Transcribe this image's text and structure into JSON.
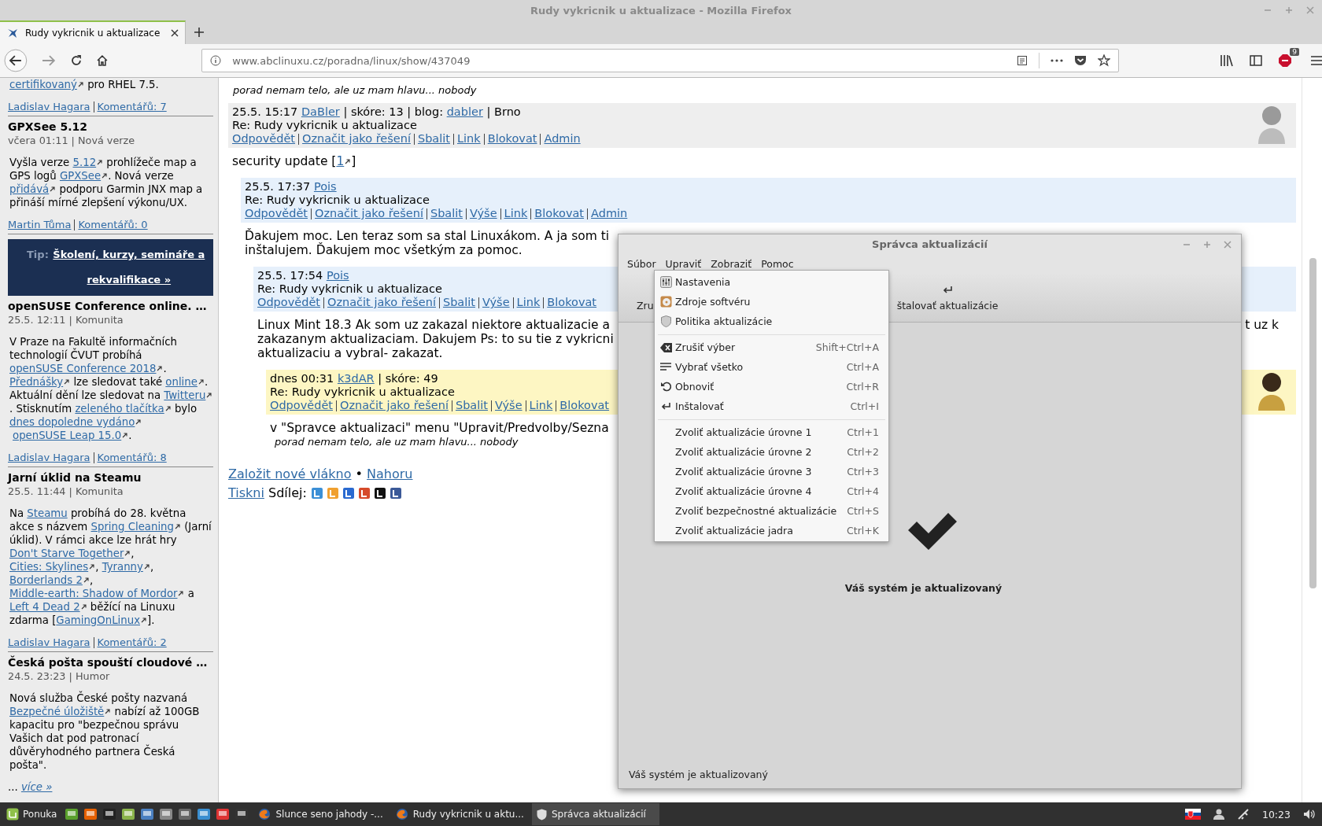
{
  "browser": {
    "title": "Rudy vykricnik u aktualizace - Mozilla Firefox",
    "tabs": [
      {
        "label": "Rudy vykricnik u aktualizace",
        "selected": true
      }
    ],
    "url": "www.abclinuxu.cz/poradna/linux/show/437049",
    "adblock_count": "9"
  },
  "sidebar": [
    {
      "kind": "article",
      "body": [
        {
          "link": "certifikovaný",
          "external": true
        },
        {
          "text": " pro RHEL 7.5."
        }
      ],
      "author": "Ladislav Hagara",
      "comments": "Komentářů: 7"
    },
    {
      "kind": "article",
      "title": "GPXSee 5.12",
      "meta": "včera 01:11 | Nová verze",
      "body": [
        {
          "text": "Vyšla verze "
        },
        {
          "link": "5.12",
          "external": true
        },
        {
          "text": " prohlížeče map a GPS logů "
        },
        {
          "link": "GPXSee",
          "external": true
        },
        {
          "text": ". Nová verze "
        },
        {
          "link": "přidává",
          "external": true
        },
        {
          "text": " podporu Garmin JNX map a přináší mírné zlepšení výkonu/UX."
        }
      ],
      "author": "Martin Tůma",
      "comments": "Komentářů: 0"
    },
    {
      "kind": "ad",
      "label": "Tip:",
      "link": "Školení, kurzy, semináře a rekvalifikace »"
    },
    {
      "kind": "article",
      "title": "openSUSE Conference online. …",
      "meta": "25.5. 12:11 | Komunita",
      "body": [
        {
          "text": "V Praze na Fakultě informačních technologií ČVUT probíhá "
        },
        {
          "link": "openSUSE Conference 2018",
          "external": true
        },
        {
          "text": ". "
        },
        {
          "link": "Přednášky",
          "external": true
        },
        {
          "text": " lze sledovat také "
        },
        {
          "link": "online",
          "external": true
        },
        {
          "text": ". Aktuální dění lze sledovat na "
        },
        {
          "link": "Twitteru",
          "external": true
        },
        {
          "text": ". Stisknutím "
        },
        {
          "link": "zeleného tlačítka",
          "external": true
        },
        {
          "text": " bylo "
        },
        {
          "link": "dnes dopoledne vydáno",
          "external": true
        },
        {
          "link": "openSUSE Leap 15.0",
          "external": true
        },
        {
          "text": "."
        }
      ],
      "author": "Ladislav Hagara",
      "comments": "Komentářů: 8"
    },
    {
      "kind": "article",
      "title": "Jarní úklid na Steamu",
      "meta": "25.5. 11:44 | Komunita",
      "body": [
        {
          "text": "Na "
        },
        {
          "link": "Steamu",
          "external": false
        },
        {
          "text": " probíhá do 28. května akce s názvem "
        },
        {
          "link": "Spring Cleaning",
          "external": true
        },
        {
          "text": " (Jarní úklid). V rámci akce lze hrát hry "
        },
        {
          "link": "Don't Starve Together",
          "external": true
        },
        {
          "text": ", "
        },
        {
          "link": "Cities: Skylines",
          "external": true
        },
        {
          "text": ", "
        },
        {
          "link": "Tyranny",
          "external": true
        },
        {
          "text": ", "
        },
        {
          "link": "Borderlands 2",
          "external": true
        },
        {
          "text": ", "
        },
        {
          "link": "Middle-earth: Shadow of Mordor",
          "external": true
        },
        {
          "text": " a "
        },
        {
          "link": "Left 4 Dead 2",
          "external": true
        },
        {
          "text": " běžící na Linuxu zdarma ["
        },
        {
          "link": "GamingOnLinux",
          "external": true
        },
        {
          "text": "]."
        }
      ],
      "author": "Ladislav Hagara",
      "comments": "Komentářů: 2"
    },
    {
      "kind": "article",
      "title": "Česká pošta spouští cloudové …",
      "meta": "24.5. 23:23 | Humor",
      "body": [
        {
          "text": "Nová služba České pošty nazvaná "
        },
        {
          "link": "Bezpečné úložiště",
          "external": true
        },
        {
          "text": " nabízí až 100GB kapacitu pro \"bezpečnou správu Vašich dat pod patronací důvěryhodného partnera Česká pošta\"."
        }
      ],
      "more_prefix": "... ",
      "more": "více »"
    }
  ],
  "thread": {
    "signature": "porad nemam telo, ale uz mam hlavu... nobody",
    "posts": [
      {
        "color": "#eeeeee",
        "avatar": true,
        "info": [
          {
            "text": "25.5. 15:17 "
          },
          {
            "link": "DaBler",
            "external": false
          },
          {
            "text": " | skóre: 13 | blog: "
          },
          {
            "link": "dabler",
            "external": false
          },
          {
            "text": " | Brno"
          }
        ],
        "subject": "Re: Rudy vykricnik u aktualizace",
        "actions": [
          "Odpovědět",
          "Označit jako řešení",
          "Sbalit",
          "Link",
          "Blokovat",
          "Admin"
        ],
        "lines": [
          {
            "segments": [
              {
                "text": "security update ["
              },
              {
                "link": "1",
                "external": true
              },
              {
                "text": "]"
              }
            ]
          }
        ],
        "children": [
          {
            "color": "#e6f0fb",
            "avatar": false,
            "info": [
              {
                "text": "25.5. 17:37 "
              },
              {
                "link": "Pois",
                "external": false
              }
            ],
            "subject": "Re: Rudy vykricnik u aktualizace",
            "actions": [
              "Odpovědět",
              "Označit jako řešení",
              "Sbalit",
              "Výše",
              "Link",
              "Blokovat",
              "Admin"
            ],
            "lines": [
              {
                "segments": [
                  {
                    "text": "Ďakujem moc. Len teraz som sa stal Linuxákom. A ja som ti"
                  }
                ]
              },
              {
                "segments": [
                  {
                    "text": "inštalujem. Ďakujem moc všetkým za pomoc."
                  }
                ]
              }
            ],
            "children": [
              {
                "color": "#e6f0fb",
                "avatar": false,
                "info": [
                  {
                    "text": "25.5. 17:54 "
                  },
                  {
                    "link": "Pois",
                    "external": false
                  }
                ],
                "subject": "Re: Rudy vykricnik u aktualizace",
                "actions": [
                  "Odpovědět",
                  "Označit jako řešení",
                  "Sbalit",
                  "Výše",
                  "Link",
                  "Blokovat"
                ],
                "lines": [
                  {
                    "segments": [
                      {
                        "text": "Linux Mint 18.3 Ak som uz zakazal niektore aktualizacie a"
                      }
                    ],
                    "continued": "t uz k"
                  },
                  {
                    "segments": [
                      {
                        "text": "zakazanym aktualizaciam. Dakujem Ps: to su tie z vykricni"
                      }
                    ]
                  },
                  {
                    "segments": [
                      {
                        "text": "aktualizaciu a vybral- zakazat."
                      }
                    ]
                  }
                ],
                "children": [
                  {
                    "color": "#fdf6c3",
                    "avatar": true,
                    "info": [
                      {
                        "text": "dnes 00:31 "
                      },
                      {
                        "link": "k3dAR",
                        "external": false
                      },
                      {
                        "text": " | skóre: 49"
                      }
                    ],
                    "subject": "Re: Rudy vykricnik u aktualizace",
                    "actions": [
                      "Odpovědět",
                      "Označit jako řešení",
                      "Sbalit",
                      "Výše",
                      "Link",
                      "Blokovat"
                    ],
                    "lines": [
                      {
                        "segments": [
                          {
                            "text": "v \"Spravce aktualizaci\" menu \"Upravit/Predvolby/Sezna"
                          }
                        ]
                      }
                    ],
                    "signature": "porad nemam telo, ale uz mam hlavu... nobody"
                  }
                ]
              }
            ]
          }
        ]
      }
    ],
    "footer": [
      [
        {
          "link": "Založit nové vlákno",
          "external": false
        },
        {
          "text": " • "
        },
        {
          "link": "Nahoru",
          "external": false
        }
      ],
      [
        {
          "link": "Tiskni",
          "external": false
        },
        {
          "text": " Sdílej: "
        }
      ]
    ]
  },
  "dialog": {
    "title": "Správca aktualizácií",
    "menubar": [
      "Súbor",
      "Upraviť",
      "Zobraziť",
      "Pomoc"
    ],
    "toolbar": [
      "Zru",
      "štalovať aktualizácie"
    ],
    "menu_groups": [
      [
        {
          "label": "Nastavenia"
        },
        {
          "label": "Zdroje softvéru"
        },
        {
          "label": "Politika aktualizácie"
        }
      ],
      [
        {
          "label": "Zrušiť výber",
          "shortcut": "Shift+Ctrl+A"
        },
        {
          "label": "Vybrať všetko",
          "shortcut": "Ctrl+A"
        },
        {
          "label": "Obnoviť",
          "shortcut": "Ctrl+R"
        },
        {
          "label": "Inštalovať",
          "shortcut": "Ctrl+I"
        }
      ],
      [
        {
          "label": "Zvoliť aktualizácie úrovne 1",
          "shortcut": "Ctrl+1"
        },
        {
          "label": "Zvoliť aktualizácie úrovne 2",
          "shortcut": "Ctrl+2"
        },
        {
          "label": "Zvoliť aktualizácie úrovne 3",
          "shortcut": "Ctrl+3"
        },
        {
          "label": "Zvoliť aktualizácie úrovne 4",
          "shortcut": "Ctrl+4"
        },
        {
          "label": "Zvoliť bezpečnostné aktualizácie",
          "shortcut": "Ctrl+S"
        },
        {
          "label": "Zvoliť aktualizácie jadra",
          "shortcut": "Ctrl+K"
        }
      ]
    ],
    "message": "Váš systém je aktualizovaný",
    "status": "Váš systém je aktualizovaný"
  },
  "taskbar": {
    "menu_label": "Ponuka",
    "tasks": [
      {
        "label": "Slunce seno jahody -...",
        "selected": false
      },
      {
        "label": "Rudy vykricnik u aktu...",
        "selected": false
      },
      {
        "label": "Správca aktualizácií",
        "selected": true
      }
    ],
    "clock": "10:23"
  }
}
